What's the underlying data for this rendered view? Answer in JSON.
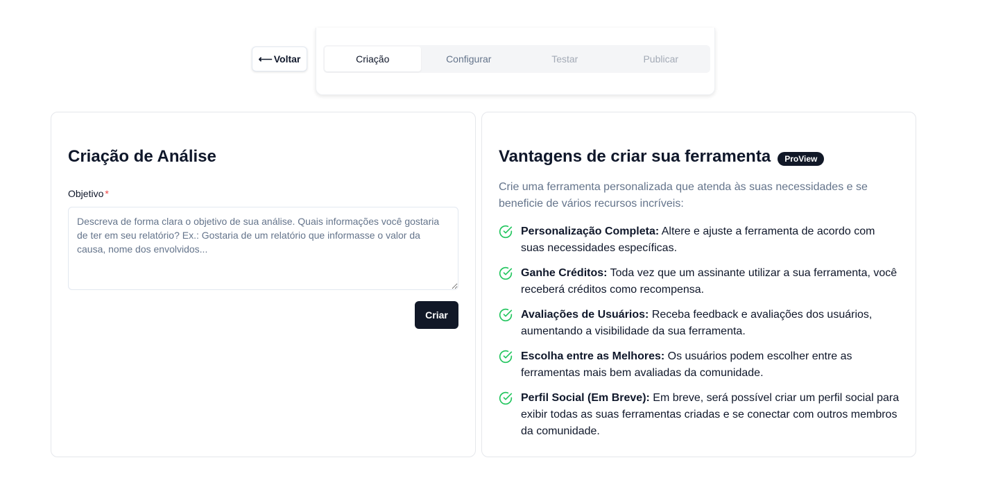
{
  "back_button": {
    "arrow": "⟵",
    "label": "Voltar"
  },
  "stepper": {
    "tabs": [
      {
        "label": "Criação",
        "state": "active"
      },
      {
        "label": "Configurar",
        "state": "enabled"
      },
      {
        "label": "Testar",
        "state": "disabled"
      },
      {
        "label": "Publicar",
        "state": "disabled"
      }
    ]
  },
  "form": {
    "title": "Criação de Análise",
    "objective_label": "Objetivo",
    "required_mark": "*",
    "objective_placeholder": "Descreva de forma clara o objetivo de sua análise. Quais informações você gostaria de ter em seu relatório? Ex.: Gostaria de um relatório que informasse o valor da causa, nome dos envolvidos...",
    "objective_value": "",
    "submit_label": "Criar"
  },
  "benefits_panel": {
    "title": "Vantagens de criar sua ferramenta",
    "badge": "ProView",
    "subtitle": "Crie uma ferramenta personalizada que atenda às suas necessidades e se beneficie de vários recursos incríveis:",
    "items": [
      {
        "title": "Personalização Completa:",
        "text": " Altere e ajuste a ferramenta de acordo com suas necessidades específicas."
      },
      {
        "title": "Ganhe Créditos:",
        "text": " Toda vez que um assinante utilizar a sua ferramenta, você receberá créditos como recompensa."
      },
      {
        "title": "Avaliações de Usuários:",
        "text": " Receba feedback e avaliações dos usuários, aumentando a visibilidade da sua ferramenta."
      },
      {
        "title": "Escolha entre as Melhores:",
        "text": " Os usuários podem escolher entre as ferramentas mais bem avaliadas da comunidade."
      },
      {
        "title": "Perfil Social (Em Breve):",
        "text": " Em breve, será possível criar um perfil social para exibir todas as suas ferramentas criadas e se conectar com outros membros da comunidade."
      }
    ],
    "icon": "check-circle-icon"
  },
  "colors": {
    "primary": "#111827",
    "check": "#22c55e",
    "required": "#ef4444",
    "muted_text": "#64748b"
  }
}
